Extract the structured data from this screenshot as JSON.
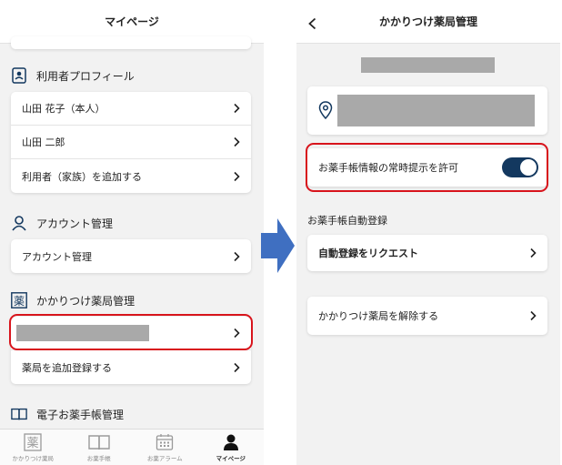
{
  "left": {
    "header_title": "マイページ",
    "profile_section": {
      "title": "利用者プロフィール",
      "items": [
        "山田 花子（本人）",
        "山田 二郎",
        "利用者（家族）を追加する"
      ]
    },
    "account_section": {
      "title": "アカウント管理",
      "items": [
        "アカウント管理"
      ]
    },
    "pharmacy_section": {
      "title": "かかりつけ薬局管理",
      "add_label": "薬局を追加登録する"
    },
    "notebook_section": {
      "title": "電子お薬手帳管理"
    },
    "tabs": [
      {
        "label": "かかりつけ薬局",
        "icon": "medicine-icon",
        "active": false
      },
      {
        "label": "お薬手帳",
        "icon": "book-icon",
        "active": false
      },
      {
        "label": "お薬アラーム",
        "icon": "calendar-icon",
        "active": false
      },
      {
        "label": "マイページ",
        "icon": "person-icon",
        "active": true
      }
    ]
  },
  "right": {
    "header_title": "かかりつけ薬局管理",
    "permanent_display_label": "お薬手帳情報の常時提示を許可",
    "toggle_on": true,
    "auto_register_heading": "お薬手帳自動登録",
    "request_label": "自動登録をリクエスト",
    "unregister_label": "かかりつけ薬局を解除する"
  },
  "colors": {
    "highlight": "#d8141c",
    "toggle": "#13385f",
    "arrow": "#3f6fc1",
    "redacted": "#a9a9a9"
  }
}
